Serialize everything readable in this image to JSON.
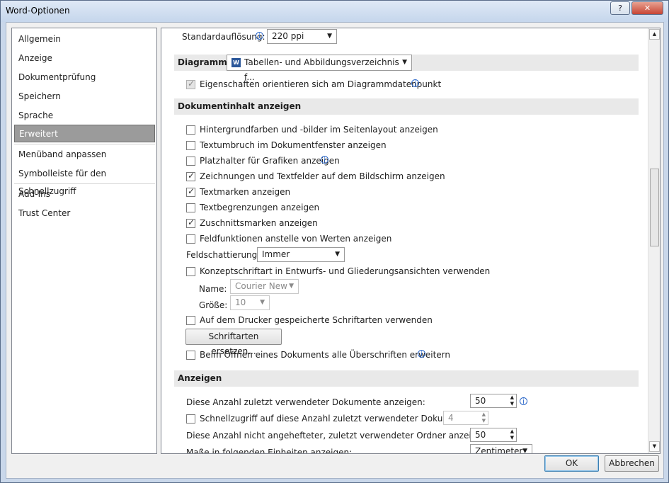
{
  "window": {
    "title": "Word-Optionen",
    "help_label": "?",
    "close_label": "✕"
  },
  "nav": {
    "items": [
      {
        "label": "Allgemein"
      },
      {
        "label": "Anzeige"
      },
      {
        "label": "Dokumentprüfung"
      },
      {
        "label": "Speichern"
      },
      {
        "label": "Sprache"
      },
      {
        "label": "Erweitert"
      },
      {
        "label": "Menüband anpassen"
      },
      {
        "label": "Symbolleiste für den Schnellzugriff"
      },
      {
        "label": "Add-Ins"
      },
      {
        "label": "Trust Center"
      }
    ],
    "selected": "Erweitert"
  },
  "content": {
    "resolution": {
      "label": "Standardauflösung:",
      "value": "220 ppi"
    },
    "diagram": {
      "header": "Diagramm",
      "doc_combo": "Tabellen- und Abbildungsverzeichnis f...",
      "orient_label": "Eigenschaften orientieren sich am Diagrammdatenpunkt"
    },
    "doc_content": {
      "header": "Dokumentinhalt anzeigen",
      "options": [
        {
          "label": "Hintergrundfarben und -bilder im Seitenlayout anzeigen",
          "checked": false
        },
        {
          "label": "Textumbruch im Dokumentfenster anzeigen",
          "checked": false
        },
        {
          "label": "Platzhalter für Grafiken anzeigen",
          "checked": false
        },
        {
          "label": "Zeichnungen und Textfelder auf dem Bildschirm anzeigen",
          "checked": true
        },
        {
          "label": "Textmarken anzeigen",
          "checked": true
        },
        {
          "label": "Textbegrenzungen anzeigen",
          "checked": false
        },
        {
          "label": "Zuschnittsmarken anzeigen",
          "checked": true
        },
        {
          "label": "Feldfunktionen anstelle von Werten anzeigen",
          "checked": false
        }
      ],
      "shading_label": "Feldschattierung:",
      "shading_value": "Immer",
      "draft_font_label": "Konzeptschriftart in Entwurfs- und Gliederungsansichten verwenden",
      "name_label": "Name:",
      "name_value": "Courier New",
      "size_label": "Größe:",
      "size_value": "10",
      "printer_fonts_label": "Auf dem Drucker gespeicherte Schriftarten verwenden",
      "replace_fonts_button": "Schriftarten ersetzen...",
      "expand_headings_label": "Beim Öffnen eines Dokuments alle Überschriften erweitern"
    },
    "display": {
      "header": "Anzeigen",
      "recent_docs_label": "Diese Anzahl zuletzt verwendeter Dokumente anzeigen:",
      "recent_docs_value": "50",
      "quick_access_label": "Schnellzugriff auf diese Anzahl zuletzt verwendeter Dokumente:",
      "quick_access_value": "4",
      "recent_folders_label": "Diese Anzahl nicht angehefteter, zuletzt verwendeter Ordner anzeigen:",
      "recent_folders_value": "50",
      "units_label": "Maße in folgenden Einheiten anzeigen:",
      "units_value": "Zentimeter"
    }
  },
  "buttons": {
    "ok": "OK",
    "cancel": "Abbrechen"
  }
}
